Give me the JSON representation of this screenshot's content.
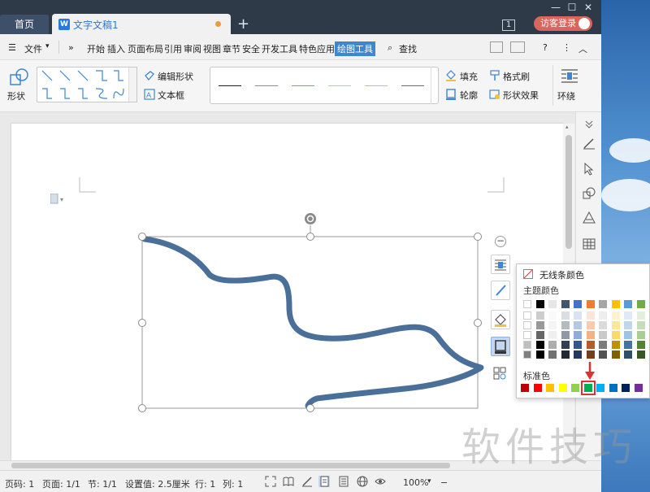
{
  "window": {
    "tab_home": "首页",
    "tab_doc": "文字文稿1",
    "badge": "1",
    "login_button": "访客登录"
  },
  "menu": {
    "file": "文件",
    "items": [
      "开始",
      "插入",
      "页面布局",
      "引用",
      "审阅",
      "视图",
      "章节",
      "安全",
      "开发工具",
      "特色应用",
      "绘图工具"
    ],
    "active": "绘图工具",
    "search": "查找"
  },
  "ribbon": {
    "shape": "形状",
    "edit_shape": "编辑形状",
    "text_box": "文本框",
    "fill": "填充",
    "outline": "轮廓",
    "format_painter": "格式刷",
    "shape_effects": "形状效果",
    "wrap": "环绕",
    "line_colors": [
      "#222222",
      "#5b9bd5",
      "#ed7d31",
      "#a5c8ea",
      "#ffc000",
      "#4472c4"
    ]
  },
  "color_popup": {
    "no_line": "无线条颜色",
    "theme_colors_label": "主题颜色",
    "standard_colors_label": "标准色",
    "theme_top_row": [
      "#ffffff",
      "#000000",
      "#e7e6e6",
      "#44546a",
      "#4472c4",
      "#ed7d31",
      "#a5a5a5",
      "#ffc000",
      "#5b9bd5",
      "#70ad47"
    ],
    "standard_colors": [
      "#c00000",
      "#ff0000",
      "#ffc000",
      "#ffff00",
      "#92d050",
      "#00b050",
      "#00b0f0",
      "#0070c0",
      "#002060",
      "#7030a0"
    ],
    "selected_standard": 5,
    "highlight_color": "#e03030"
  },
  "statusbar": {
    "page_no": "页码: 1",
    "pages": "页面: 1/1",
    "section": "节: 1/1",
    "setting": "设置值: 2.5厘米",
    "row": "行: 1",
    "col": "列: 1",
    "zoom": "100%"
  },
  "drawing": {
    "stroke_color": "#4a6f98"
  },
  "watermark": "软件技巧"
}
